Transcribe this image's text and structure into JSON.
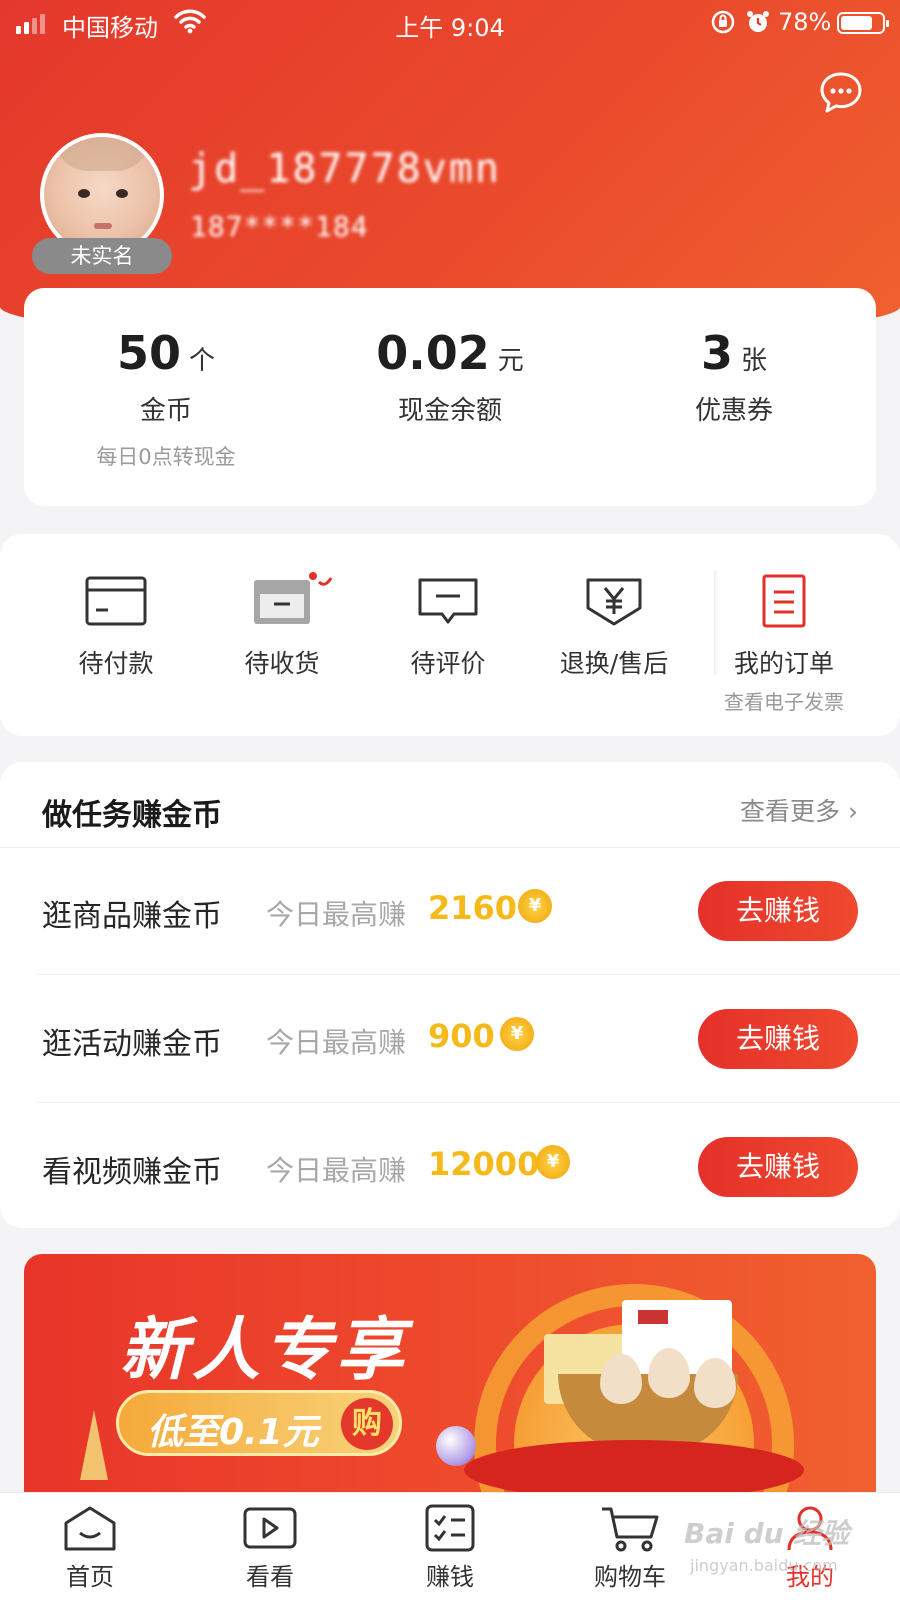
{
  "status_bar": {
    "carrier": "中国移动",
    "time": "上午 9:04",
    "battery_pct": "78%",
    "battery_level": 0.78
  },
  "profile": {
    "username": "jd_187778vmn",
    "phone": "187****184",
    "badge": "未实名"
  },
  "assets": [
    {
      "value": "50",
      "unit": "个",
      "label": "金币",
      "sub": "每日0点转现金"
    },
    {
      "value": "0.02",
      "unit": "元",
      "label": "现金余额",
      "sub": ""
    },
    {
      "value": "3",
      "unit": "张",
      "label": "优惠券",
      "sub": ""
    }
  ],
  "orders": [
    {
      "icon": "wallet-card-icon",
      "label": "待付款",
      "sub": ""
    },
    {
      "icon": "delivery-box-icon",
      "label": "待收货",
      "sub": ""
    },
    {
      "icon": "review-chat-icon",
      "label": "待评价",
      "sub": ""
    },
    {
      "icon": "refund-yen-icon",
      "label": "退换/售后",
      "sub": ""
    },
    {
      "icon": "order-list-icon",
      "label": "我的订单",
      "sub": "查看电子发票"
    }
  ],
  "tasks": {
    "title": "做任务赚金币",
    "more": "查看更多 ›",
    "items": [
      {
        "name": "逛商品赚金币",
        "prefix": "今日最高赚",
        "amount": "2160",
        "button": "去赚钱"
      },
      {
        "name": "逛活动赚金币",
        "prefix": "今日最高赚",
        "amount": "900",
        "button": "去赚钱"
      },
      {
        "name": "看视频赚金币",
        "prefix": "今日最高赚",
        "amount": "12000",
        "button": "去赚钱"
      }
    ],
    "coin_symbol": "¥"
  },
  "banner": {
    "headline": "新人专享",
    "pill_text": "低至0.1元",
    "pill_buy": "购"
  },
  "tabs": [
    {
      "label": "首页",
      "icon": "home-icon",
      "active": false
    },
    {
      "label": "看看",
      "icon": "video-play-icon",
      "active": false
    },
    {
      "label": "赚钱",
      "icon": "task-list-icon",
      "active": false
    },
    {
      "label": "购物车",
      "icon": "cart-icon",
      "active": false
    },
    {
      "label": "我的",
      "icon": "user-icon",
      "active": true
    }
  ],
  "watermark": {
    "text": "Bai du 经验",
    "sub": "jingyan.baidu.com"
  },
  "colors": {
    "brand_red": "#e4302a",
    "coin_gold": "#f5b91a"
  }
}
